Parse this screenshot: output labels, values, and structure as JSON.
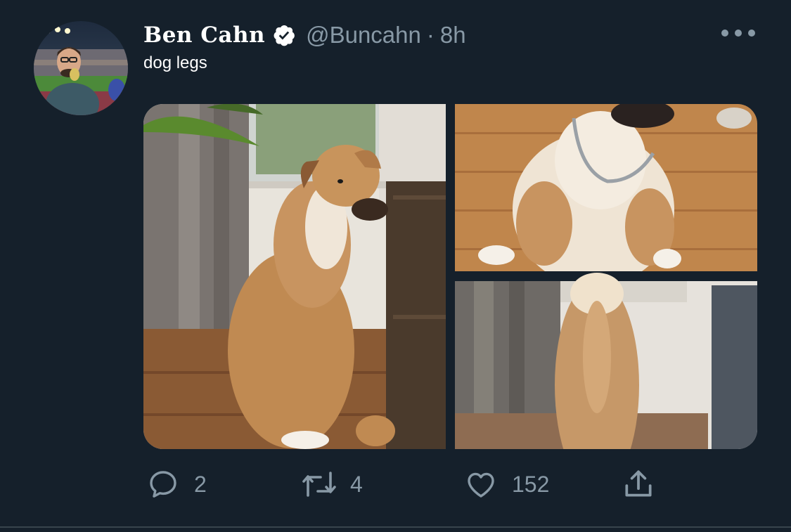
{
  "author": {
    "display_name": "Ben Cahn",
    "handle": "@Buncahn",
    "separator": "·",
    "time": "8h",
    "avatar_icon": "avatar-photo",
    "verified_icon": "verified-badge-icon"
  },
  "tweet": {
    "text": "dog legs",
    "media": [
      {
        "description": "dog-sitting-window"
      },
      {
        "description": "dog-sitting-floor"
      },
      {
        "description": "dog-back-curtains"
      }
    ]
  },
  "actions": {
    "reply_count": "2",
    "retweet_count": "4",
    "like_count": "152",
    "reply_icon": "reply-icon",
    "retweet_icon": "retweet-icon",
    "like_icon": "heart-icon",
    "share_icon": "share-icon",
    "more_icon": "more-options-icon"
  },
  "colors": {
    "background": "#15202b",
    "secondary_text": "#8899a6",
    "divider": "#38444d"
  }
}
